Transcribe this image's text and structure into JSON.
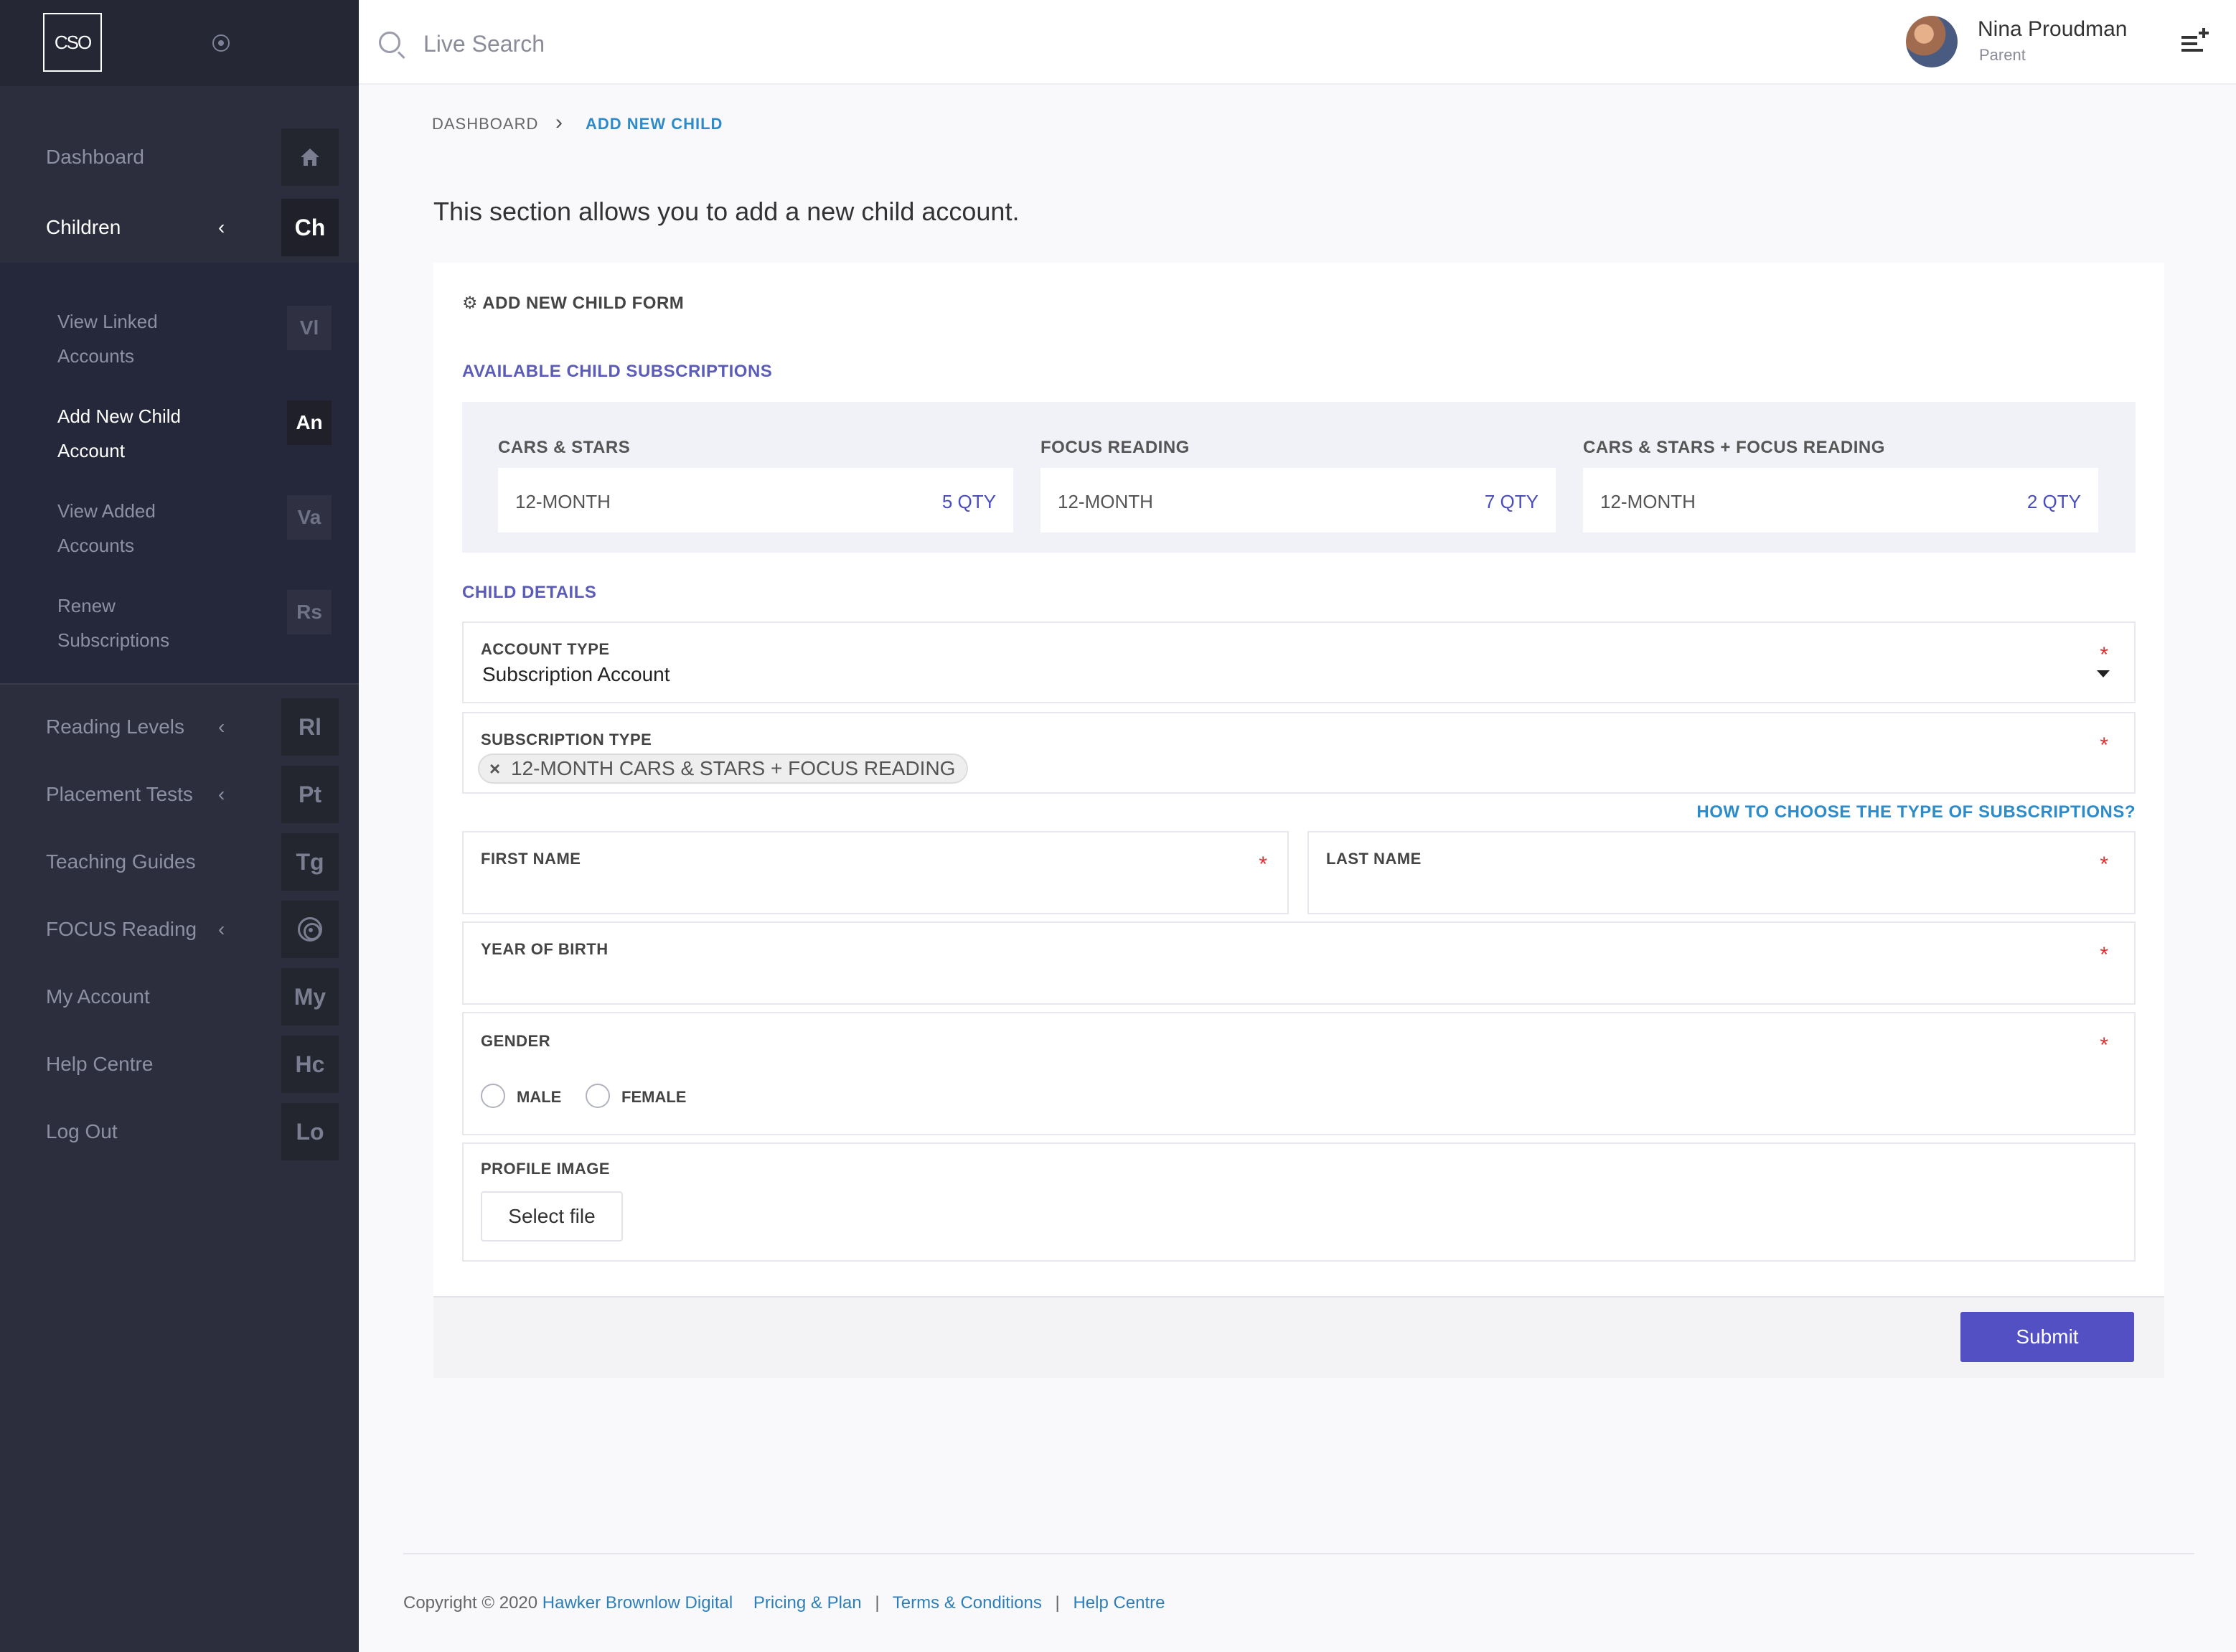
{
  "sidebar": {
    "logo_text": "CSO",
    "nav": [
      {
        "label": "Dashboard",
        "abbr": "",
        "icon": "home-icon"
      },
      {
        "label": "Children",
        "abbr": "Ch"
      },
      {
        "label": "Reading Levels",
        "abbr": "Rl"
      },
      {
        "label": "Placement Tests",
        "abbr": "Pt"
      },
      {
        "label": "Teaching Guides",
        "abbr": "Tg"
      },
      {
        "label": "FOCUS Reading",
        "abbr": "",
        "icon": "target-icon"
      },
      {
        "label": "My Account",
        "abbr": "My"
      },
      {
        "label": "Help Centre",
        "abbr": "Hc"
      },
      {
        "label": "Log Out",
        "abbr": "Lo"
      }
    ],
    "children_sub": [
      {
        "label": "View Linked Accounts",
        "abbr": "Vl"
      },
      {
        "label": "Add New Child Account",
        "abbr": "An"
      },
      {
        "label": "View Added Accounts",
        "abbr": "Va"
      },
      {
        "label": "Renew Subscriptions",
        "abbr": "Rs"
      }
    ]
  },
  "topbar": {
    "search_placeholder": "Live Search",
    "user_name": "Nina Proudman",
    "user_role": "Parent"
  },
  "breadcrumb": {
    "home": "DASHBOARD",
    "current": "ADD NEW CHILD"
  },
  "intro": "This section allows you to add a new child account.",
  "form": {
    "title": "ADD NEW CHILD FORM",
    "subscriptions_title": "AVAILABLE CHILD SUBSCRIPTIONS",
    "subscriptions": [
      {
        "name": "CARS & STARS",
        "term": "12-MONTH",
        "qty": "5 QTY"
      },
      {
        "name": "FOCUS READING",
        "term": "12-MONTH",
        "qty": "7 QTY"
      },
      {
        "name": "CARS & STARS + FOCUS READING",
        "term": "12-MONTH",
        "qty": "2 QTY"
      }
    ],
    "details_title": "CHILD DETAILS",
    "account_type_label": "ACCOUNT TYPE",
    "account_type_value": "Subscription Account",
    "subscription_type_label": "SUBSCRIPTION TYPE",
    "subscription_type_tag": "12-MONTH CARS & STARS + FOCUS READING",
    "help_link": "HOW TO CHOOSE THE TYPE OF SUBSCRIPTIONS?",
    "first_name_label": "FIRST NAME",
    "last_name_label": "LAST NAME",
    "year_of_birth_label": "YEAR OF BIRTH",
    "gender_label": "GENDER",
    "gender_male": "MALE",
    "gender_female": "FEMALE",
    "profile_image_label": "PROFILE IMAGE",
    "select_file": "Select file",
    "submit": "Submit",
    "required_mark": "*"
  },
  "footer": {
    "copyright": "Copyright © 2020",
    "company": "Hawker Brownlow Digital",
    "pricing": "Pricing & Plan",
    "terms": "Terms & Conditions",
    "help": "Help Centre",
    "separator": "|"
  },
  "colors": {
    "sidebar_bg": "#2c2e3e",
    "accent_blue": "#2e8bc9",
    "accent_indigo": "#5350c4",
    "required_red": "#e0302e"
  }
}
